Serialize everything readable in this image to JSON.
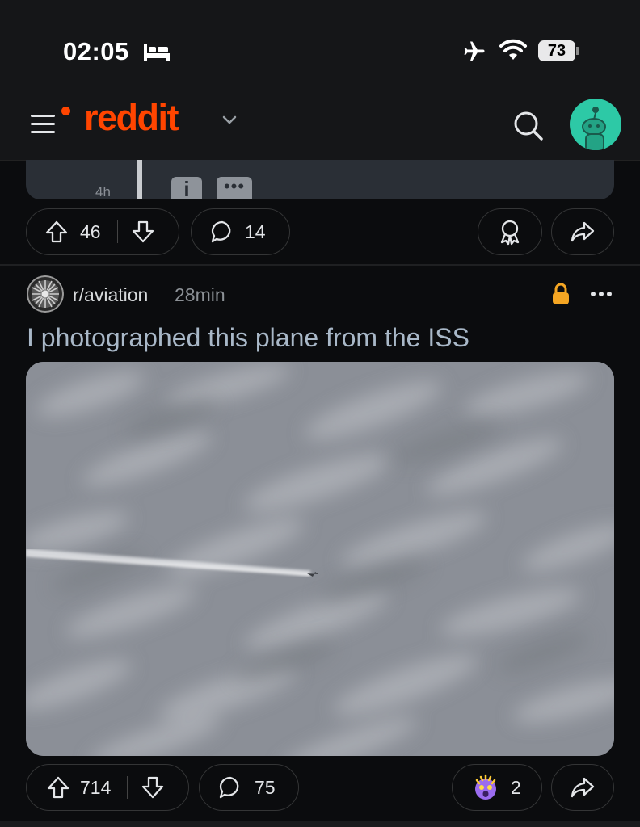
{
  "status_bar": {
    "time": "02:05",
    "battery": "73"
  },
  "header": {
    "logo": "reddit"
  },
  "previous_post": {
    "time": "4h",
    "info_label": "i",
    "more_label": "•••",
    "upvotes": "46",
    "comments": "14"
  },
  "post": {
    "subreddit": "r/aviation",
    "time": "28min",
    "title": "I photographed this plane from the ISS",
    "upvotes": "714",
    "comments": "75",
    "awards": "2"
  },
  "colors": {
    "brand": "#ff4500",
    "background": "#0b0c0e",
    "lock": "#f5a623",
    "avatar": "#2dc9a6"
  }
}
